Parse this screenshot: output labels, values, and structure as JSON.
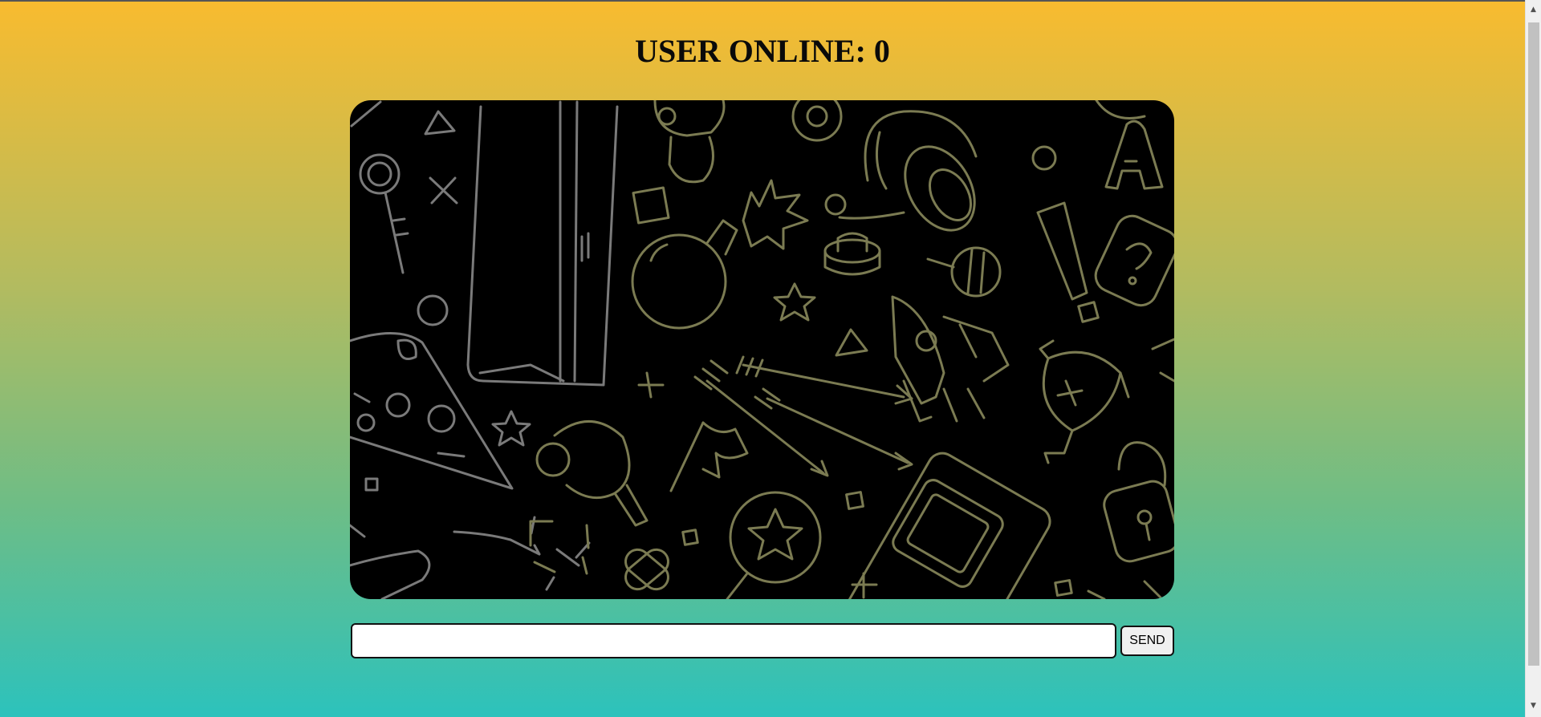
{
  "header": {
    "title": "USER ONLINE: 0"
  },
  "chat": {
    "background_icons": [
      "ring-icon",
      "key-icon",
      "console-icon",
      "mushroom-icon",
      "headphones-icon",
      "bomb-icon",
      "trophy-icon",
      "rocket-icon",
      "arrow-icon",
      "star-icon",
      "pizza-icon",
      "ping-pong-icon",
      "flag-icon",
      "gamepad-icon",
      "handheld-console-icon",
      "padlock-icon",
      "exclamation-icon",
      "question-block-icon",
      "letter-a-icon",
      "lollipop-icon",
      "triangle-icon",
      "square-icon",
      "circle-icon",
      "cross-icon",
      "bandage-icon",
      "medal-icon"
    ],
    "line_color": "#8a8a5a",
    "background_color": "#000000"
  },
  "composer": {
    "input_value": "",
    "input_placeholder": "",
    "send_label": "SEND"
  },
  "colors": {
    "gradient_top": "#f8bb2f",
    "gradient_bottom": "#2cc2bc"
  },
  "scrollbar": {
    "up_arrow": "▲",
    "down_arrow": "▼"
  }
}
